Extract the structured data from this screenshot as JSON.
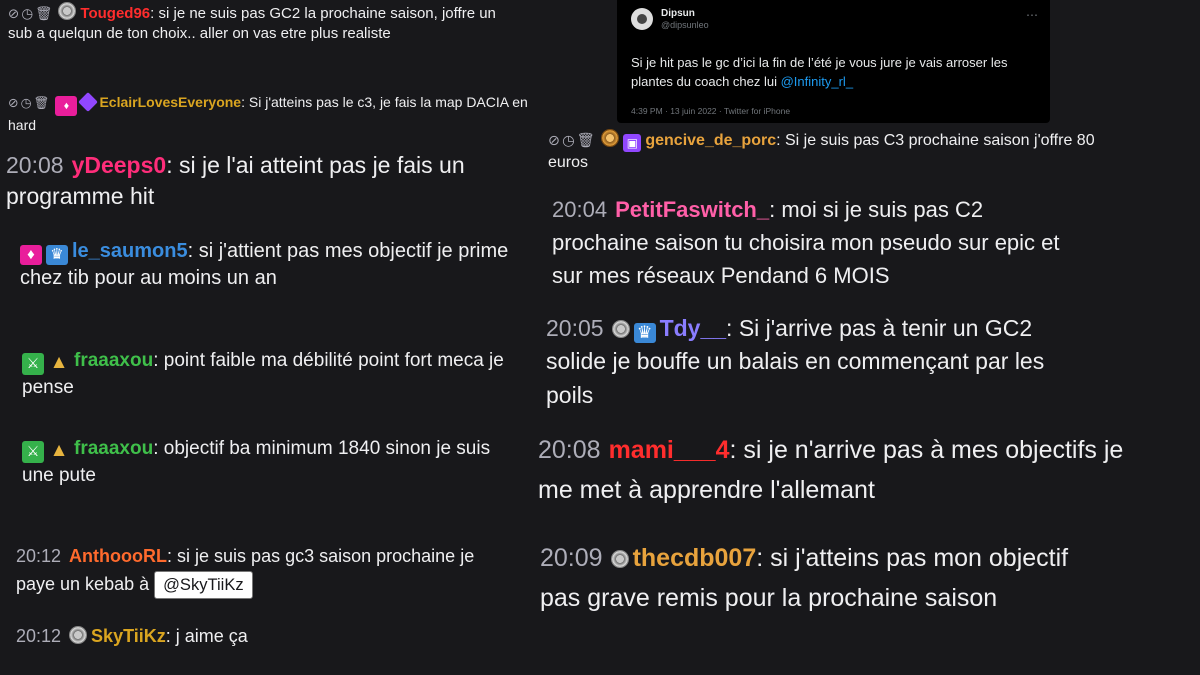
{
  "tweet": {
    "name": "Dipsun",
    "handle": "@dipsunleo",
    "more_icon": "ellipsis-icon",
    "text": "Si je hit pas le gc d’ici la fin de l’été je vous jure je vais arroser les plantes du coach chez lui ",
    "mention": "@Infinity_rl_",
    "meta": "4:39 PM · 13 juin 2022 · Twitter for iPhone"
  },
  "messages": [
    {
      "id": "touged",
      "time": "",
      "badges": [
        "mod-tools",
        "bits-gray"
      ],
      "user": "Touged96",
      "color": "#ff2d2d",
      "text": "si je ne suis pas GC2 la prochaine saison, joffre un sub a quelqun de ton choix.. aller on vas etre plus realiste"
    },
    {
      "id": "eclair",
      "time": "",
      "badges": [
        "mod-tools",
        "prime",
        "purple-gem"
      ],
      "user": "EclairLovesEveryone",
      "color": "#daa520",
      "text": "Si j'atteins pas le c3, je fais la map DACIA en hard"
    },
    {
      "id": "ydeeps",
      "time": "20:08",
      "badges": [],
      "user": "yDeeps0",
      "color": "#ff2d7a",
      "text": "si je l'ai atteint pas je fais un programme hit"
    },
    {
      "id": "saumon",
      "time": "",
      "badges": [
        "prime",
        "crown"
      ],
      "user": "le_saumon5",
      "color": "#3a8ddf",
      "text": "si j'attient pas mes objectif je prime chez tib pour au moins un an"
    },
    {
      "id": "fraaaxou1",
      "time": "",
      "badges": [
        "sword",
        "pyramid"
      ],
      "user": "fraaaxou",
      "color": "#3fbf4a",
      "text": "point faible ma débilité point fort meca je pense"
    },
    {
      "id": "fraaaxou2",
      "time": "",
      "badges": [
        "sword",
        "pyramid"
      ],
      "user": "fraaaxou",
      "color": "#3fbf4a",
      "text": "objectif ba minimum 1840 sinon je suis une pute"
    },
    {
      "id": "anthooo",
      "time": "20:12",
      "badges": [],
      "user": "AnthoooRL",
      "color": "#ff6a2d",
      "text": "si je suis pas gc3 saison prochaine je paye un kebab à ",
      "mention": "@SkyTiiKz"
    },
    {
      "id": "skytiikz",
      "time": "20:12",
      "badges": [
        "bits-gray"
      ],
      "user": "SkyTiiKz",
      "color": "#daa520",
      "text": "j aime ça"
    },
    {
      "id": "gencive",
      "time": "",
      "badges": [
        "mod-tools",
        "bits-gold",
        "gift"
      ],
      "user": "gencive_de_porc",
      "color": "#e8a33d",
      "text": "Si je suis pas C3 prochaine saison j'offre 80 euros"
    },
    {
      "id": "petitfa",
      "time": "20:04",
      "badges": [],
      "user": "PetitFaswitch_",
      "color": "#ff5fa8",
      "text": "moi si je suis pas C2 prochaine saison tu choisira mon pseudo sur epic et sur mes réseaux Pendand 6 MOIS"
    },
    {
      "id": "tdy",
      "time": "20:05",
      "badges": [
        "bits-gray",
        "crown"
      ],
      "user": "Tdy__",
      "color": "#8a7dff",
      "text": "Si j'arrive pas à tenir un GC2 solide je bouffe un balais en commençant par les poils"
    },
    {
      "id": "mami",
      "time": "20:08",
      "badges": [],
      "user": "mami___4",
      "color": "#ff2d2d",
      "text": "si je n'arrive pas à mes objectifs je me met à apprendre l'allemant"
    },
    {
      "id": "thecdb",
      "time": "20:09",
      "badges": [
        "bits-gray"
      ],
      "user": "thecdb007",
      "color": "#e8a33d",
      "text": "si j'atteins pas mon objectif pas grave remis pour la prochaine saison"
    }
  ]
}
